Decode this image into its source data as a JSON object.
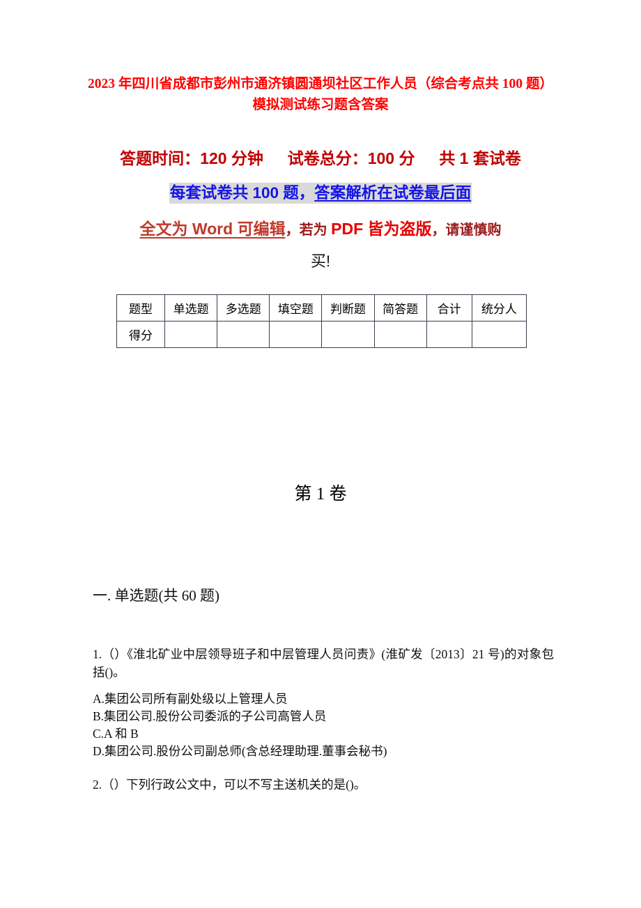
{
  "document": {
    "title_line1": "2023 年四川省成都市彭州市通济镇圆通坝社区工作人员（综合考点共 100 题）",
    "title_line2": "模拟测试练习题含答案",
    "exam_info": {
      "time_label": "答题时间：120 分钟",
      "total_score_label": "试卷总分：100 分",
      "set_count_label": "共 1 套试卷"
    },
    "notice_blue": {
      "part1": "每套试卷共 100 题，",
      "part2": "答案解析在试卷最后面"
    },
    "warning": {
      "part1": "全文为 Word 可编辑",
      "part2": "，若为 ",
      "part3": "PDF 皆为盗版",
      "part4": "，请谨慎购",
      "part5": "买!"
    },
    "score_table": {
      "headers": [
        "题型",
        "单选题",
        "多选题",
        "填空题",
        "判断题",
        "简答题",
        "合计",
        "统分人"
      ],
      "rows": [
        {
          "label": "得分",
          "values": [
            "",
            "",
            "",
            "",
            "",
            "",
            ""
          ]
        }
      ]
    },
    "volume_heading": "第 1 卷",
    "section_heading": "一. 单选题(共 60 题)",
    "questions": [
      {
        "stem": "1.（）《淮北矿业中层领导班子和中层管理人员问责》(淮矿发〔2013〕21 号)的对象包括()。",
        "options": [
          "A.集团公司所有副处级以上管理人员",
          "B.集团公司.股份公司委派的子公司高管人员",
          "C.A 和 B",
          "D.集团公司.股份公司副总师(含总经理助理.董事会秘书)"
        ]
      },
      {
        "stem": "2.（）下列行政公文中，可以不写主送机关的是()。",
        "options": []
      }
    ]
  },
  "colors": {
    "title_red": "#FF0000",
    "info_red": "#C00000",
    "blue_text": "#1414E6",
    "shade_gray": "#D9D9D9",
    "warn_orange_red": "#C0392B",
    "warn_dark_red": "#9C1B1B",
    "warn_bright_red": "#E60000",
    "table_border": "#3D3D4F"
  }
}
